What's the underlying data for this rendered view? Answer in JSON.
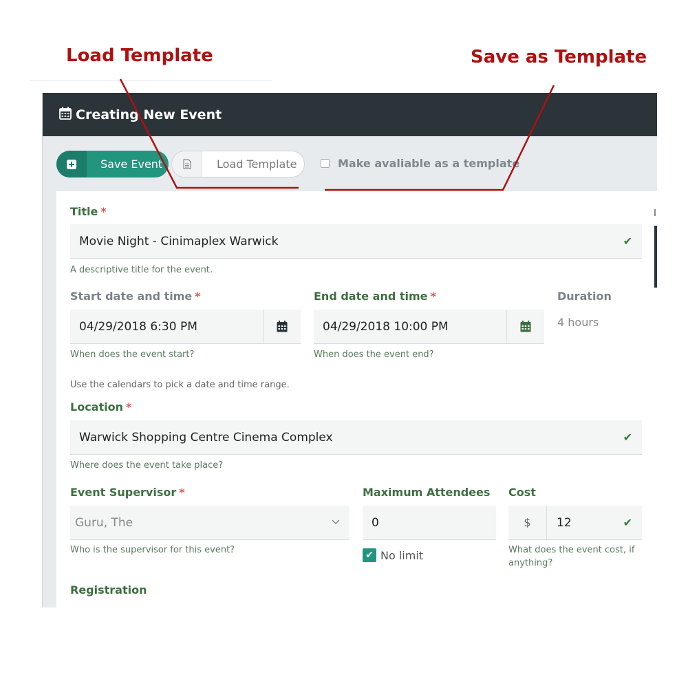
{
  "annotations": {
    "load_template": "Load Template",
    "save_as_template": "Save as Template",
    "accent_color": "#b01010"
  },
  "window": {
    "title": "Creating New Event",
    "icon": "calendar-icon"
  },
  "toolbar": {
    "save_label": "Save Event",
    "save_icon": "plus-square-icon",
    "load_label": "Load Template",
    "load_icon": "document-icon",
    "template_checkbox_label": "Make avaliable as a template",
    "template_checked": false
  },
  "form": {
    "title": {
      "label": "Title",
      "required": "*",
      "value": "Movie Night - Cinimaplex Warwick",
      "help": "A descriptive title for the event."
    },
    "start": {
      "label": "Start date and time",
      "required": "*",
      "value": "04/29/2018 6:30 PM",
      "help": "When does the event start?"
    },
    "end": {
      "label": "End date and time",
      "required": "*",
      "value": "04/29/2018 10:00 PM",
      "help": "When does the event end?"
    },
    "duration": {
      "label": "Duration",
      "value": "4 hours"
    },
    "range_help": "Use the calendars to pick a date and time range.",
    "location": {
      "label": "Location",
      "required": "*",
      "value": "Warwick Shopping Centre Cinema Complex",
      "help": "Where does the event take place?"
    },
    "supervisor": {
      "label": "Event Supervisor",
      "required": "*",
      "value": "Guru, The",
      "help": "Who is the supervisor for this event?"
    },
    "attendees": {
      "label": "Maximum Attendees",
      "value": "0",
      "no_limit_label": "No limit",
      "no_limit_checked": true
    },
    "cost": {
      "label": "Cost",
      "prefix": "$",
      "value": "12",
      "help": "What does the event cost, if anything?"
    },
    "registration": {
      "label": "Registration"
    }
  },
  "colors": {
    "header": "#2b3439",
    "primary": "#22957f",
    "label_green": "#3d7040",
    "required_red": "#e05555"
  }
}
